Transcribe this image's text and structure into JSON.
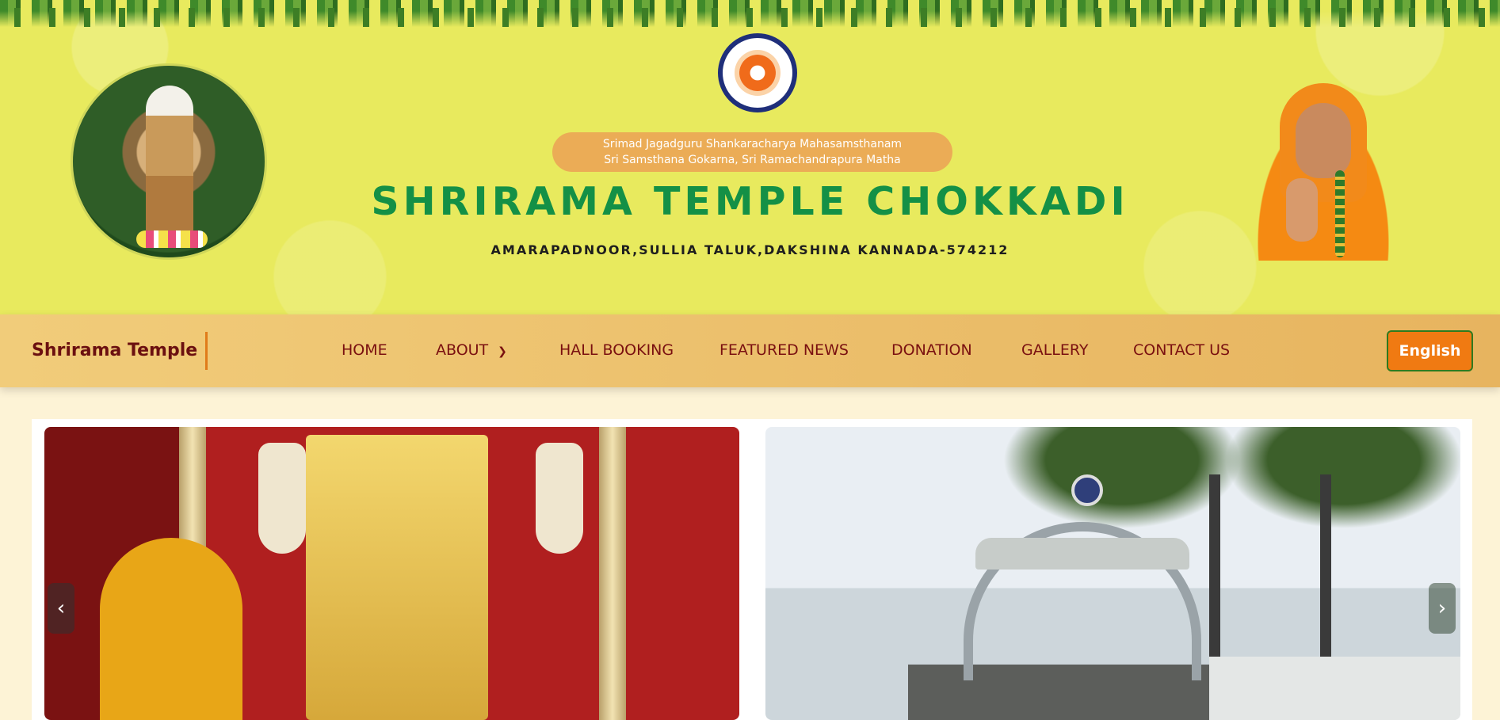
{
  "banner": {
    "matha_line1": "Srimad Jagadguru Shankaracharya Mahasamsthanam",
    "matha_line2": "Sri Samsthana Gokarna, Sri Ramachandrapura Matha",
    "title": "SHRIRAMA TEMPLE CHOKKADI",
    "address": "AMARAPADNOOR,SULLIA TALUK,DAKSHINA KANNADA-574212"
  },
  "navbar": {
    "brand": "Shrirama Temple",
    "items": [
      {
        "label": "HOME"
      },
      {
        "label": "ABOUT",
        "icon": "chevron-down-icon"
      },
      {
        "label": "HALL BOOKING"
      },
      {
        "label": "FEATURED NEWS"
      },
      {
        "label": "DONATION"
      },
      {
        "label": "GALLERY"
      },
      {
        "label": "CONTACT US"
      }
    ],
    "language": "English"
  },
  "carousel": {
    "prev_icon": "‹",
    "next_icon": "›"
  },
  "colors": {
    "banner_bg": "#e8ea5e",
    "title_green": "#149046",
    "nav_text": "#7a1010",
    "accent_orange": "#f07a12"
  }
}
